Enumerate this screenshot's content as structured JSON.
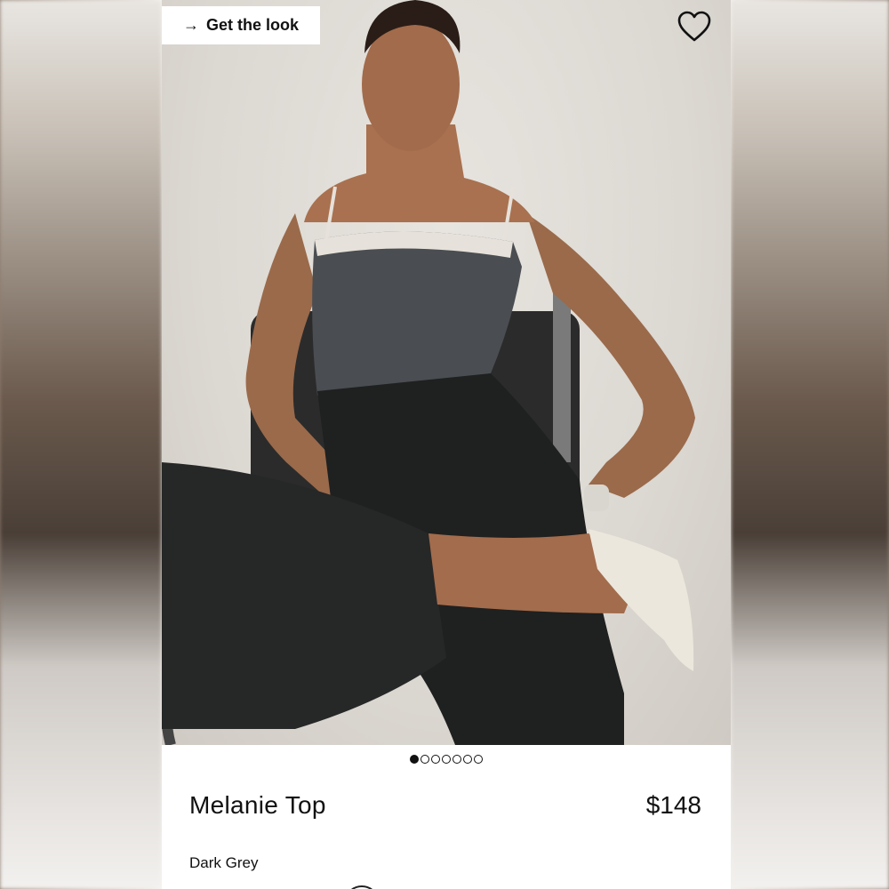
{
  "background": {
    "panel_color": "#ffffff",
    "photo_bg": "#dedad4"
  },
  "hero": {
    "get_look_arrow": "→",
    "get_look_label": "Get the look",
    "favorite_icon": "heart-icon"
  },
  "carousel": {
    "total": 7,
    "active_index": 0
  },
  "product": {
    "name": "Melanie Top",
    "price": "$148",
    "color": "Dark Grey"
  }
}
